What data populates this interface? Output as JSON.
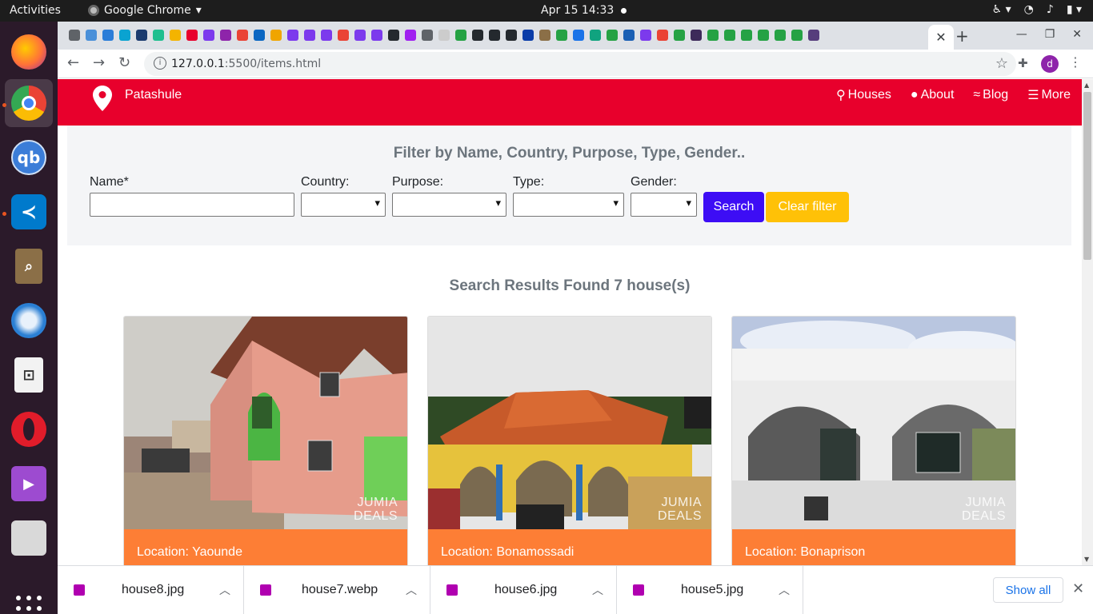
{
  "system": {
    "activities": "Activities",
    "app_name": "Google Chrome",
    "clock": "Apr 15  14:33"
  },
  "dock": {
    "apps": [
      {
        "name": "firefox",
        "color": "#ff7139"
      },
      {
        "name": "chrome",
        "color": "#4285f4"
      },
      {
        "name": "qbittorrent",
        "color": "#3b7dd8",
        "label": "qb"
      },
      {
        "name": "vscode",
        "color": "#007acc"
      },
      {
        "name": "reader",
        "color": "#8b6f47"
      },
      {
        "name": "thunderbird",
        "color": "#2a7fd4"
      },
      {
        "name": "text-editor",
        "color": "#e8e8e8"
      },
      {
        "name": "opera",
        "color": "#e11c2a"
      },
      {
        "name": "media-player",
        "color": "#9d4bd0"
      },
      {
        "name": "files",
        "color": "#d9d9d9"
      }
    ]
  },
  "browser": {
    "favicon_colors": [
      "#5f6368",
      "#4a90d9",
      "#2b7dd8",
      "#0aa3d1",
      "#1b3b6f",
      "#1fbf8f",
      "#f4b400",
      "#e8002c",
      "#7c3aed",
      "#8e24aa",
      "#ea4335",
      "#0a66c2",
      "#f0a500",
      "#7c3aed",
      "#7c3aed",
      "#7c3aed",
      "#ea4335",
      "#7c3aed",
      "#7c3aed",
      "#24292e",
      "#a020f0",
      "#5f6368",
      "#cccccc",
      "#25a244",
      "#24292e",
      "#24292e",
      "#24292e",
      "#0a3ca8",
      "#8b6f47",
      "#25a244",
      "#1a73e8",
      "#10a37f",
      "#25a244",
      "#1a5fb4",
      "#7c3aed",
      "#ea4335",
      "#25a244",
      "#3d2a5a",
      "#25a244",
      "#25a244",
      "#25a244",
      "#25a244",
      "#25a244",
      "#25a244",
      "#563d7c"
    ],
    "url_host": "127.0.0.1",
    "url_rest": ":5500/items.html",
    "profile_initial": "d"
  },
  "site": {
    "brand": "Patashule",
    "nav": [
      {
        "icon": "search-icon",
        "label": "Houses"
      },
      {
        "icon": "user-icon",
        "label": "About"
      },
      {
        "icon": "wifi-icon",
        "label": "Blog"
      },
      {
        "icon": "menu-icon",
        "label": "More"
      }
    ],
    "filter": {
      "title": "Filter by Name, Country, Purpose, Type, Gender..",
      "name_label": "Name*",
      "name_value": "",
      "country_label": "Country:",
      "purpose_label": "Purpose:",
      "type_label": "Type:",
      "gender_label": "Gender:",
      "country_value": "",
      "purpose_value": "",
      "type_value": "",
      "gender_value": "",
      "search_button": "Search",
      "clear_button": "Clear filter"
    },
    "results": {
      "title": "Search Results Found 7 house(s)"
    },
    "cards": [
      {
        "location": "Location: Yaounde",
        "watermark_top": "JUMIA",
        "watermark_bottom": "DEALS"
      },
      {
        "location": "Location: Bonamossadi",
        "watermark_top": "JUMIA",
        "watermark_bottom": "DEALS"
      },
      {
        "location": "Location: Bonaprison",
        "watermark_top": "JUMIA",
        "watermark_bottom": "DEALS"
      }
    ]
  },
  "downloads": {
    "items": [
      {
        "filename": "house8.jpg"
      },
      {
        "filename": "house7.webp"
      },
      {
        "filename": "house6.jpg"
      },
      {
        "filename": "house5.jpg"
      }
    ],
    "show_all": "Show all"
  }
}
